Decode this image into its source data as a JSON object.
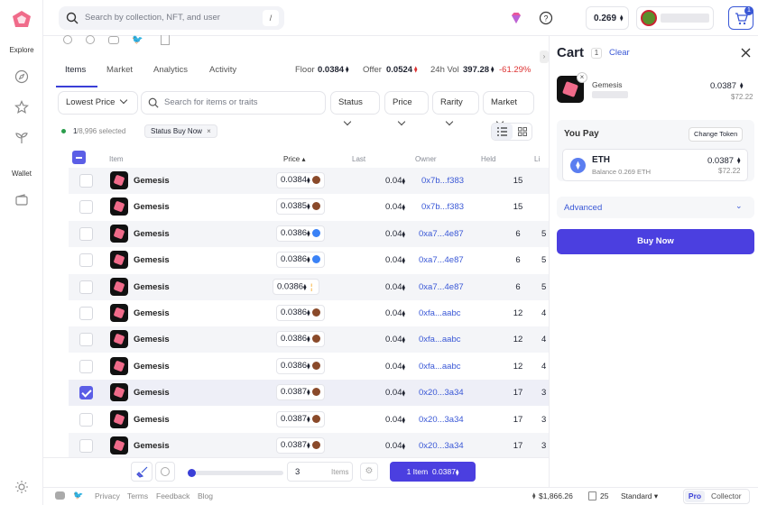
{
  "rail": {
    "explore": "Explore",
    "wallet": "Wallet"
  },
  "topbar": {
    "search_placeholder": "Search by collection, NFT, and user",
    "slash": "/",
    "balance": "0.269",
    "cart_count": "1"
  },
  "tabs": [
    "Items",
    "Market",
    "Analytics",
    "Activity"
  ],
  "stats": {
    "floor_label": "Floor",
    "floor_value": "0.0384",
    "offer_label": "Offer",
    "offer_value": "0.0524",
    "vol_label": "24h Vol",
    "vol_value": "397.28",
    "vol_change": "-61.29%"
  },
  "filters": {
    "sort": "Lowest Price",
    "search_placeholder": "Search for items or traits",
    "status": "Status",
    "price": "Price",
    "rarity": "Rarity",
    "market": "Market"
  },
  "selection": {
    "count": "1",
    "total": "/8,996 selected",
    "chip": "Status Buy Now"
  },
  "columns": {
    "item": "Item",
    "price": "Price",
    "last": "Last",
    "owner": "Owner",
    "held": "Held",
    "listed": "Li"
  },
  "rows": [
    {
      "name": "Gemesis",
      "price": "0.0384",
      "coin": "brown",
      "last": "0.04",
      "owner": "0x7b...f383",
      "held": "15",
      "lc": "",
      "checked": false
    },
    {
      "name": "Gemesis",
      "price": "0.0385",
      "coin": "brown",
      "last": "0.04",
      "owner": "0x7b...f383",
      "held": "15",
      "lc": "",
      "checked": false
    },
    {
      "name": "Gemesis",
      "price": "0.0386",
      "coin": "blue",
      "last": "0.04",
      "owner": "0xa7...4e87",
      "held": "6",
      "lc": "5",
      "checked": false
    },
    {
      "name": "Gemesis",
      "price": "0.0386",
      "coin": "blue",
      "last": "0.04",
      "owner": "0xa7...4e87",
      "held": "6",
      "lc": "5",
      "checked": false
    },
    {
      "name": "Gemesis",
      "price": "0.0386",
      "coin": "orange",
      "last": "0.04",
      "owner": "0xa7...4e87",
      "held": "6",
      "lc": "5",
      "checked": false
    },
    {
      "name": "Gemesis",
      "price": "0.0386",
      "coin": "brown",
      "last": "0.04",
      "owner": "0xfa...aabc",
      "held": "12",
      "lc": "4",
      "checked": false
    },
    {
      "name": "Gemesis",
      "price": "0.0386",
      "coin": "brown",
      "last": "0.04",
      "owner": "0xfa...aabc",
      "held": "12",
      "lc": "4",
      "checked": false
    },
    {
      "name": "Gemesis",
      "price": "0.0386",
      "coin": "brown",
      "last": "0.04",
      "owner": "0xfa...aabc",
      "held": "12",
      "lc": "4",
      "checked": false
    },
    {
      "name": "Gemesis",
      "price": "0.0387",
      "coin": "brown",
      "last": "0.04",
      "owner": "0x20...3a34",
      "held": "17",
      "lc": "3",
      "checked": true
    },
    {
      "name": "Gemesis",
      "price": "0.0387",
      "coin": "brown",
      "last": "0.04",
      "owner": "0x20...3a34",
      "held": "17",
      "lc": "3",
      "checked": false
    },
    {
      "name": "Gemesis",
      "price": "0.0387",
      "coin": "brown",
      "last": "0.04",
      "owner": "0x20...3a34",
      "held": "17",
      "lc": "3",
      "checked": false
    }
  ],
  "footer": {
    "qty": "3",
    "qty_unit": "Items",
    "buy_label": "1 Item",
    "buy_price": "0.0387"
  },
  "statusbar": {
    "privacy": "Privacy",
    "terms": "Terms",
    "feedback": "Feedback",
    "blog": "Blog",
    "eth_price": "$1,866.26",
    "gas": "25",
    "mode": "Standard",
    "pro": "Pro",
    "collector": "Collector"
  },
  "cart": {
    "title": "Cart",
    "count": "1",
    "clear": "Clear",
    "item_name": "Gemesis",
    "item_price": "0.0387",
    "item_usd": "$72.22",
    "you_pay": "You Pay",
    "change_token": "Change Token",
    "token": "ETH",
    "token_balance": "Balance 0.269 ETH",
    "pay_price": "0.0387",
    "pay_usd": "$72.22",
    "advanced": "Advanced",
    "buy_now": "Buy Now"
  }
}
